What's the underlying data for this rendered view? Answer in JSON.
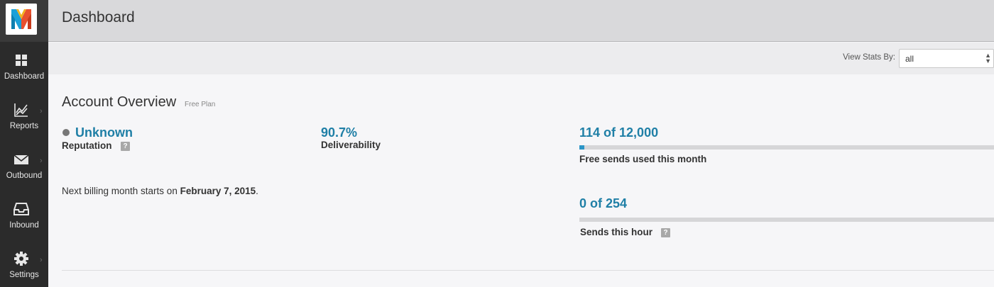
{
  "header": {
    "title": "Dashboard"
  },
  "sidebar": {
    "items": [
      {
        "label": "Dashboard",
        "icon": "grid-icon",
        "active": true
      },
      {
        "label": "Reports",
        "icon": "chart-icon",
        "has_submenu": true
      },
      {
        "label": "Outbound",
        "icon": "envelope-icon",
        "has_submenu": true
      },
      {
        "label": "Inbound",
        "icon": "inbox-icon",
        "has_submenu": true
      },
      {
        "label": "Settings",
        "icon": "gear-icon",
        "has_submenu": true
      }
    ]
  },
  "stats_filter": {
    "label": "View Stats By:",
    "selected": "all"
  },
  "overview": {
    "title": "Account Overview",
    "plan": "Free Plan",
    "reputation": {
      "value": "Unknown",
      "label": "Reputation",
      "help": "?"
    },
    "deliverability": {
      "value": "90.7%",
      "label": "Deliverability"
    },
    "billing": {
      "prefix": "Next billing month starts on ",
      "date": "February 7, 2015",
      "suffix": "."
    },
    "monthly_sends": {
      "value": "114 of 12,000",
      "label": "Free sends used this month",
      "used": 114,
      "limit": 12000
    },
    "hourly_sends": {
      "value": "0 of 254",
      "label": "Sends this hour",
      "help": "?",
      "used": 0,
      "limit": 254
    }
  },
  "colors": {
    "accent": "#1f7fa6",
    "bar_fill": "#2c95c7",
    "sidebar_bg": "#2b2b2b"
  }
}
